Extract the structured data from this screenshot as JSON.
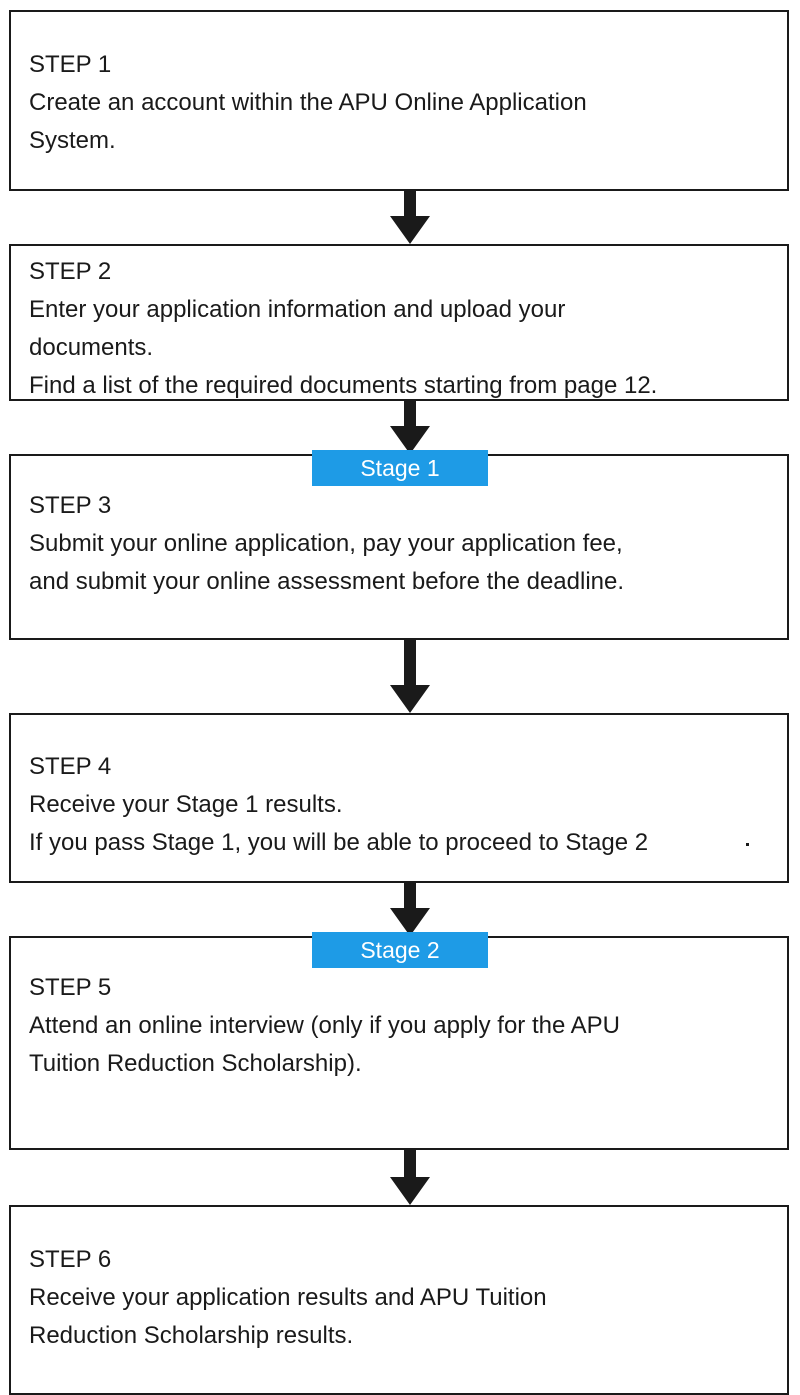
{
  "accent_color": "#1e9be6",
  "steps": [
    {
      "label": "STEP 1",
      "lines": [
        "Create an account within the APU Online Application",
        "System."
      ]
    },
    {
      "label": "STEP 2",
      "lines": [
        "Enter your application information and upload your",
        "documents.",
        "Find a list of the required documents starting from page 12."
      ]
    },
    {
      "label": "STEP 3",
      "stage": "Stage 1",
      "lines": [
        "Submit your online application, pay your application fee,",
        "and submit your online assessment before the deadline."
      ]
    },
    {
      "label": "STEP 4",
      "lines": [
        "Receive your Stage 1 results.",
        "If you pass Stage 1, you will be able to proceed to Stage 2"
      ]
    },
    {
      "label": "STEP 5",
      "stage": "Stage 2",
      "lines": [
        "Attend an online interview (only if you apply for the APU",
        "Tuition Reduction Scholarship)."
      ]
    },
    {
      "label": "STEP 6",
      "lines": [
        "Receive your application results and APU Tuition",
        "Reduction Scholarship results."
      ]
    }
  ],
  "arrow_icon": "down-arrow-icon"
}
